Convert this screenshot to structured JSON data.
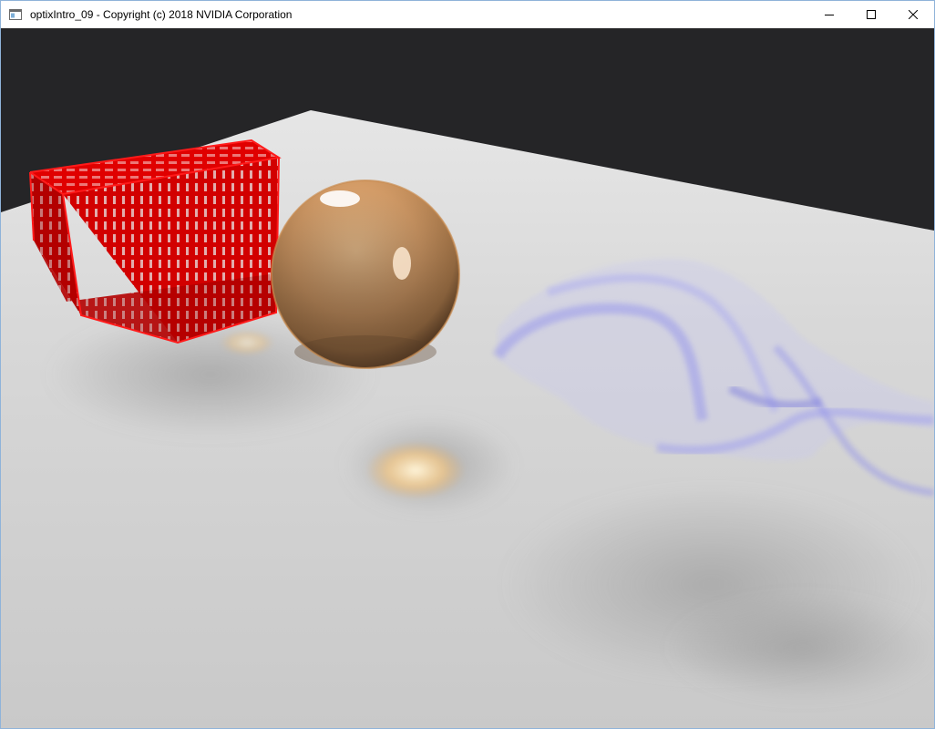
{
  "window": {
    "title": "optixIntro_09 - Copyright (c) 2018 NVIDIA Corporation",
    "icons": [
      "app-icon",
      "minimize-icon",
      "maximize-icon",
      "close-icon"
    ]
  },
  "viewport": {
    "background_color": "#252527",
    "floor_color": "#d3d3d3",
    "objects": [
      {
        "name": "wireframe cube",
        "color": "#d40000"
      },
      {
        "name": "glass sphere",
        "color": "#d9a36a"
      },
      {
        "name": "translucent ribbon",
        "color": "#7a7ae6"
      }
    ]
  }
}
